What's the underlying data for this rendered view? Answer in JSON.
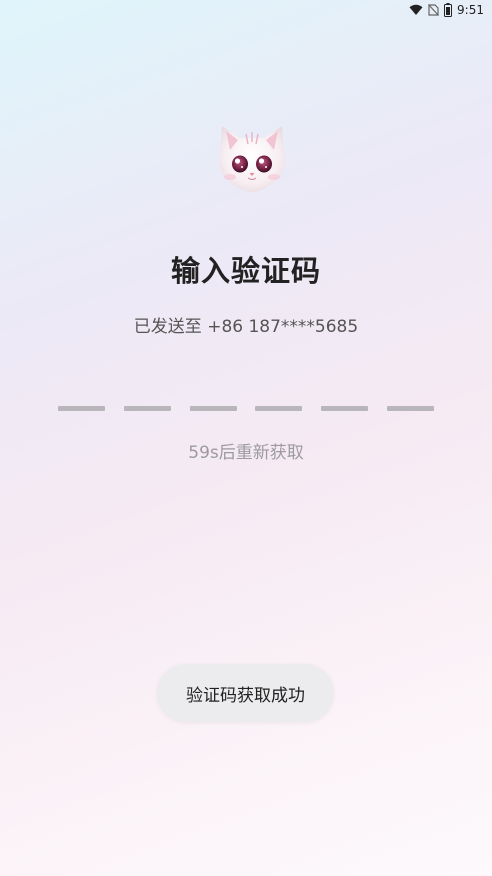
{
  "status_bar": {
    "time": "9:51",
    "icons": [
      "wifi-icon",
      "no-sim-icon",
      "battery-icon"
    ]
  },
  "header": {
    "avatar": "cat-avatar",
    "title": "输入验证码",
    "subtitle": "已发送至 +86 187****5685"
  },
  "code_input": {
    "length": 6,
    "entered": ""
  },
  "resend_text": "59s后重新获取",
  "toast": {
    "message": "验证码获取成功"
  }
}
